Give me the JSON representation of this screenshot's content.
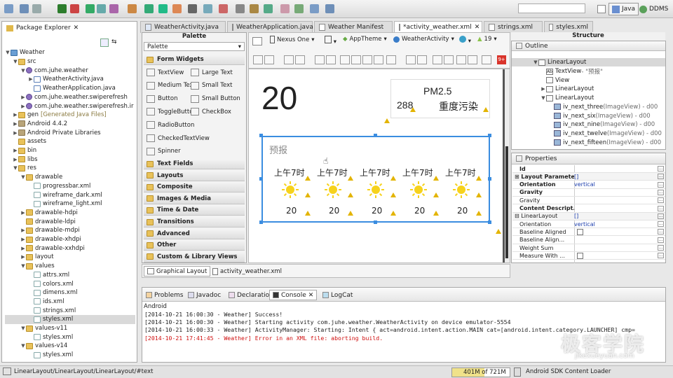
{
  "toolbar": {
    "perspective_java": "Java",
    "perspective_ddms": "DDMS"
  },
  "package_explorer": {
    "title": "Package Explorer",
    "items": [
      {
        "label": "Weather",
        "depth": 0,
        "type": "proj",
        "twist": "▼"
      },
      {
        "label": "src",
        "depth": 1,
        "type": "folder",
        "twist": "▼"
      },
      {
        "label": "com.juhe.weather",
        "depth": 2,
        "type": "pkg",
        "twist": "▼"
      },
      {
        "label": "WeatherActivity.java",
        "depth": 3,
        "type": "java",
        "twist": "▶"
      },
      {
        "label": "WeatherApplication.java",
        "depth": 3,
        "type": "java",
        "twist": ""
      },
      {
        "label": "com.juhe.weather.swiperefresh",
        "depth": 2,
        "type": "pkg",
        "twist": "▶"
      },
      {
        "label": "com.juhe.weather.swiperefresh.ir",
        "depth": 2,
        "type": "pkg",
        "twist": "▶"
      },
      {
        "label": "gen",
        "extra": "[Generated Java Files]",
        "depth": 1,
        "type": "folder",
        "twist": "▶"
      },
      {
        "label": "Android 4.4.2",
        "depth": 1,
        "type": "lib",
        "twist": "▶"
      },
      {
        "label": "Android Private Libraries",
        "depth": 1,
        "type": "lib",
        "twist": "▶"
      },
      {
        "label": "assets",
        "depth": 1,
        "type": "folder",
        "twist": ""
      },
      {
        "label": "bin",
        "depth": 1,
        "type": "folder",
        "twist": "▶"
      },
      {
        "label": "libs",
        "depth": 1,
        "type": "folder",
        "twist": "▶"
      },
      {
        "label": "res",
        "depth": 1,
        "type": "folder",
        "twist": "▼"
      },
      {
        "label": "drawable",
        "depth": 2,
        "type": "folder",
        "twist": "▼"
      },
      {
        "label": "progressbar.xml",
        "depth": 3,
        "type": "xml",
        "twist": ""
      },
      {
        "label": "wireframe_dark.xml",
        "depth": 3,
        "type": "xml",
        "twist": ""
      },
      {
        "label": "wireframe_light.xml",
        "depth": 3,
        "type": "xml",
        "twist": ""
      },
      {
        "label": "drawable-hdpi",
        "depth": 2,
        "type": "folder",
        "twist": "▶"
      },
      {
        "label": "drawable-ldpi",
        "depth": 2,
        "type": "folder",
        "twist": ""
      },
      {
        "label": "drawable-mdpi",
        "depth": 2,
        "type": "folder",
        "twist": "▶"
      },
      {
        "label": "drawable-xhdpi",
        "depth": 2,
        "type": "folder",
        "twist": "▶"
      },
      {
        "label": "drawable-xxhdpi",
        "depth": 2,
        "type": "folder",
        "twist": "▶"
      },
      {
        "label": "layout",
        "depth": 2,
        "type": "folder",
        "twist": "▶"
      },
      {
        "label": "values",
        "depth": 2,
        "type": "folder",
        "twist": "▼"
      },
      {
        "label": "attrs.xml",
        "depth": 3,
        "type": "xml",
        "twist": ""
      },
      {
        "label": "colors.xml",
        "depth": 3,
        "type": "xml",
        "twist": ""
      },
      {
        "label": "dimens.xml",
        "depth": 3,
        "type": "xml",
        "twist": ""
      },
      {
        "label": "ids.xml",
        "depth": 3,
        "type": "xml",
        "twist": ""
      },
      {
        "label": "strings.xml",
        "depth": 3,
        "type": "xml",
        "twist": ""
      },
      {
        "label": "styles.xml",
        "depth": 3,
        "type": "xml",
        "twist": "",
        "selected": true
      },
      {
        "label": "values-v11",
        "depth": 2,
        "type": "folder",
        "twist": "▼"
      },
      {
        "label": "styles.xml",
        "depth": 3,
        "type": "xml",
        "twist": ""
      },
      {
        "label": "values-v14",
        "depth": 2,
        "type": "folder",
        "twist": "▼"
      },
      {
        "label": "styles.xml",
        "depth": 3,
        "type": "xml",
        "twist": ""
      }
    ]
  },
  "editor_tabs": [
    "WeatherActivity.java",
    "WeatherApplication.java",
    "Weather Manifest",
    "*activity_weather.xml",
    "strings.xml",
    "styles.xml"
  ],
  "structure_title": "Structure",
  "palette": {
    "title": "Palette",
    "dropdown": "Palette",
    "form_widgets": "Form Widgets",
    "widgets": [
      {
        "left": "TextView",
        "right": "Large Text"
      },
      {
        "left": "Medium Text",
        "right": "Small Text"
      },
      {
        "left": "Button",
        "right": "Small Button"
      },
      {
        "left": "ToggleButton",
        "right": "CheckBox"
      },
      {
        "left": "RadioButton",
        "right": ""
      },
      {
        "left": "CheckedTextView",
        "right": ""
      },
      {
        "left": "Spinner",
        "right": ""
      }
    ],
    "categories": [
      "Text Fields",
      "Layouts",
      "Composite",
      "Images & Media",
      "Time & Date",
      "Transitions",
      "Advanced",
      "Other",
      "Custom & Library Views"
    ]
  },
  "canvas_toolbar": {
    "device": "Nexus One",
    "theme": "AppTheme",
    "activity": "WeatherActivity",
    "api": "19"
  },
  "preview": {
    "temperature": "20",
    "pm_label": "PM2.5",
    "pm_value": "288",
    "pm_quality": "重度污染",
    "forecast_label": "预报",
    "forecast": [
      {
        "time": "上午7时",
        "temp": "20"
      },
      {
        "time": "上午7时",
        "temp": "20"
      },
      {
        "time": "上午7时",
        "temp": "20"
      },
      {
        "time": "上午7时",
        "temp": "20"
      },
      {
        "time": "上午7时",
        "temp": "20"
      }
    ]
  },
  "editor_bottom_tabs": [
    "Graphical Layout",
    "activity_weather.xml"
  ],
  "outline": {
    "title": "Outline",
    "rows": [
      {
        "label": "LinearLayout",
        "depth": 0,
        "twist": "▼",
        "icon": "box",
        "extra": ""
      },
      {
        "label": "TextView",
        "depth": 1,
        "twist": "",
        "icon": "ab",
        "extra": " - \"预报\""
      },
      {
        "label": "View",
        "depth": 1,
        "twist": "",
        "icon": "box",
        "extra": ""
      },
      {
        "label": "LinearLayout",
        "depth": 1,
        "twist": "▶",
        "icon": "box",
        "extra": ""
      },
      {
        "label": "LinearLayout",
        "depth": 1,
        "twist": "▼",
        "icon": "box",
        "extra": ""
      },
      {
        "label": "iv_next_three",
        "depth": 2,
        "twist": "",
        "icon": "img",
        "extra": " (ImageView) - d00"
      },
      {
        "label": "iv_next_six",
        "depth": 2,
        "twist": "",
        "icon": "img",
        "extra": " (ImageView) - d00"
      },
      {
        "label": "iv_next_nine",
        "depth": 2,
        "twist": "",
        "icon": "img",
        "extra": " (ImageView) - d00"
      },
      {
        "label": "iv_next_twelve",
        "depth": 2,
        "twist": "",
        "icon": "img",
        "extra": " (ImageView) - d00"
      },
      {
        "label": "iv_next_fifteen",
        "depth": 2,
        "twist": "",
        "icon": "img",
        "extra": " (ImageView) - d00"
      }
    ]
  },
  "properties": {
    "title": "Properties",
    "rows": [
      {
        "key": "Id",
        "value": "",
        "bold": true
      },
      {
        "key": "Layout Parameters",
        "value": "[]",
        "bold": true,
        "twist": "⊞"
      },
      {
        "key": "Orientation",
        "value": "vertical",
        "bold": true
      },
      {
        "key": "Gravity",
        "value": "",
        "bold": true
      },
      {
        "key": "Gravity",
        "value": "",
        "bold": false
      },
      {
        "key": "Content Descript...",
        "value": "",
        "bold": true
      },
      {
        "key": "LinearLayout",
        "value": "[]",
        "bold": false,
        "twist": "⊟"
      },
      {
        "key": "Orientation",
        "value": "vertical",
        "bold": false
      },
      {
        "key": "Baseline Aligned",
        "value": "",
        "bold": false,
        "check": true
      },
      {
        "key": "Baseline Align...",
        "value": "",
        "bold": false
      },
      {
        "key": "Weight Sum",
        "value": "",
        "bold": false
      },
      {
        "key": "Measure With ...",
        "value": "",
        "bold": false,
        "check": true
      }
    ]
  },
  "console": {
    "tabs": [
      "Problems",
      "Javadoc",
      "Declaration",
      "Console",
      "LogCat"
    ],
    "subtitle": "Android",
    "lines": [
      {
        "text": "[2014-10-21 16:00:30 - Weather] Success!",
        "error": false
      },
      {
        "text": "[2014-10-21 16:00:30 - Weather] Starting activity com.juhe.weather.WeatherActivity on device emulator-5554",
        "error": false
      },
      {
        "text": "[2014-10-21 16:00:33 - Weather] ActivityManager: Starting: Intent { act=android.intent.action.MAIN cat=[android.intent.category.LAUNCHER] cmp=",
        "error": false
      },
      {
        "text": "[2014-10-21 17:41:45 - Weather] Error in an XML file: aborting build.",
        "error": true
      }
    ]
  },
  "status": {
    "path": "LinearLayout/LinearLayout/LinearLayout/#text",
    "heap": "401M of 721M",
    "heap_fraction": 0.56,
    "task": "Android SDK Content Loader"
  },
  "watermark": {
    "text": "极客学院",
    "url": "jikexueyuan.com"
  }
}
